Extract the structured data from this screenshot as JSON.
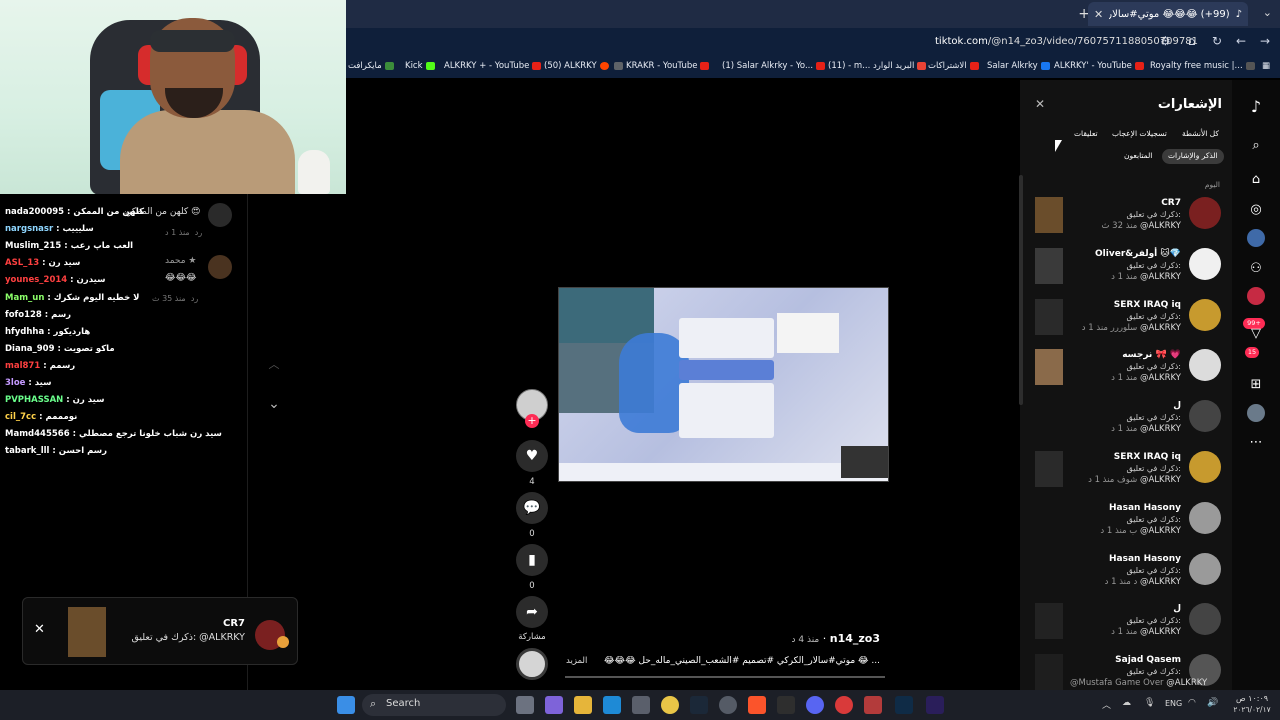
{
  "browser": {
    "tab_title": "(99+) 😂😂😂 موتي#سالار_الكر",
    "url_domain": "tiktok.com",
    "url_path": "/@n14_zo3/video/7607571188050709781",
    "bookmarks": [
      {
        "label": "مايكرافت",
        "color": "#3b8d3a"
      },
      {
        "label": "Kick",
        "color": "#53fc18"
      },
      {
        "label": "ALKRKY + - YouTube",
        "color": "#e62117"
      },
      {
        "label": "(50) ALKRKY",
        "color": "#ff4500"
      },
      {
        "label": "KRAKR - YouTube",
        "color": "#e62117"
      },
      {
        "label": "(1) Salar Alkrky - Yo...",
        "color": "#e62117"
      },
      {
        "label": "(11) - m... البريد الوارد",
        "color": "#ea4335"
      },
      {
        "label": "الاشتراكات",
        "color": "#e62117"
      },
      {
        "label": "Salar Alkrky",
        "color": "#1877f2"
      },
      {
        "label": "ALKRKY' - YouTube",
        "color": "#e62117"
      },
      {
        "label": "Royalty free music |...",
        "color": "#555555"
      }
    ]
  },
  "chat": {
    "top_comment": {
      "text": "كلهن من الممكن 😍",
      "time": "منذ 1 د",
      "reply": "رد"
    },
    "second_comment": {
      "name": "محمد ★",
      "text": "😂😂😂",
      "time": "منذ 35 ث",
      "reply": "رد"
    },
    "messages": [
      {
        "user": "nada200095",
        "color": "#ffffff",
        "text": "كلهن من الممكن",
        "user_color": "#ffffff"
      },
      {
        "user": "nargsnasr",
        "text": "سليييب",
        "user_color": "#8fd6ff"
      },
      {
        "user": "Muslim_215",
        "text": "العب ماپ رعب",
        "user_color": "#ffffff"
      },
      {
        "user": "ASL_13",
        "text": "سيد رن",
        "user_color": "#ff4040"
      },
      {
        "user": "younes_2014",
        "text": "سيدرن",
        "user_color": "#ff4040"
      },
      {
        "user": "Mam_un",
        "text": "لا خطيه اليوم شكرك",
        "user_color": "#8cff6a"
      },
      {
        "user": "fofo128",
        "text": "رسم",
        "user_color": "#ffffff"
      },
      {
        "user": "hfydhha",
        "text": "هارديكور",
        "user_color": "#ffffff"
      },
      {
        "user": "Diana_909",
        "text": "ماكو تصويت",
        "user_color": "#ffffff"
      },
      {
        "user": "mal871",
        "text": "رسمم",
        "user_color": "#ff4040"
      },
      {
        "user": "3loe",
        "text": "سيد",
        "user_color": "#c59aff"
      },
      {
        "user": "PVPHASSAN",
        "text": "سيد رن",
        "user_color": "#6aff8c"
      },
      {
        "user": "cil_7cc",
        "text": "نومممم",
        "user_color": "#ffd24a"
      },
      {
        "user": "Mamd445566",
        "text": "سيد رن شباب خلونا ترجع مصطلي",
        "user_color": "#ffffff"
      },
      {
        "user": "tabark_lll",
        "text": "رسم احسن",
        "user_color": "#ffffff"
      }
    ]
  },
  "toast": {
    "name": "CR7",
    "text": "ذكرك في تعليق: @ALKRKY"
  },
  "video": {
    "likes": "4",
    "comments": "0",
    "saves": "0",
    "share_label": "مشاركة",
    "author": "n14_zo3",
    "when": "منذ 4 د",
    "caption": "😂😂😂 موتي#سالار_الكركي #تصميم #الشعب_الصيني_ماله_حل 😂 ...",
    "more_label": "المزيد"
  },
  "notifications": {
    "title": "الإشعارات",
    "chips": [
      "كل الأنشطة",
      "تسجيلات الإعجاب",
      "تعليقات",
      "الذكر والإشارات",
      "المتابعون"
    ],
    "section": "اليوم",
    "items": [
      {
        "name": "CR7",
        "sub": "ذكرك في تعليق:",
        "meta": "@ALKRKY",
        "time": "منذ 32 ث",
        "av": "#7a2020",
        "thumb": "#6a4d2b"
      },
      {
        "name": "Oliver&أولفر 🐱💎",
        "sub": "ذكرك في تعليق:",
        "meta": "@ALKRKY",
        "time": "منذ 1 د",
        "av": "#f0f0f0",
        "thumb": "#3a3a3a"
      },
      {
        "name": "SERX IRAQ iq",
        "sub": "ذكرك في تعليق:",
        "meta": "@ALKRKY",
        "time": "سلوررر منذ 1 د",
        "av": "#c79a2e",
        "thumb": "#2a2a2a"
      },
      {
        "name": "نرجسه 🎀 💗",
        "sub": "ذكرك في تعليق:",
        "meta": "@ALKRKY",
        "time": "منذ 1 د",
        "av": "#dcdcdc",
        "thumb": "#8a6a4a"
      },
      {
        "name": "ل",
        "sub": "ذكرك في تعليق:",
        "meta": "@ALKRKY",
        "time": "منذ 1 د",
        "av": "#444444",
        "thumb": ""
      },
      {
        "name": "SERX IRAQ iq",
        "sub": "ذكرك في تعليق:",
        "meta": "@ALKRKY",
        "time": "شوف منذ 1 د",
        "av": "#c79a2e",
        "thumb": "#2a2a2a"
      },
      {
        "name": "Hasan Hasony",
        "sub": "ذكرك في تعليق:",
        "meta": "@ALKRKY",
        "time": "ب منذ 1 د",
        "av": "#9a9a9a",
        "thumb": ""
      },
      {
        "name": "Hasan Hasony",
        "sub": "ذكرك في تعليق:",
        "meta": "@ALKRKY",
        "time": "د منذ 1 د",
        "av": "#9a9a9a",
        "thumb": ""
      },
      {
        "name": "ل",
        "sub": "ذكرك في تعليق:",
        "meta": "@ALKRKY",
        "time": "منذ 1 د",
        "av": "#444444",
        "thumb": "#222222"
      },
      {
        "name": "Sajad Qasem",
        "sub": "ذكرك في تعليق:",
        "meta": "@ALKRKY",
        "time": "@Mustafa Game Over",
        "av": "#555555",
        "thumb": "#1e1e1e"
      }
    ]
  },
  "sidebar_badges": {
    "inbox": "99+",
    "messages": "15"
  },
  "taskbar": {
    "search_label": "Search",
    "language": "ENG",
    "time": "١٠:٠٩ ص",
    "date": "٢٠٢٦/٠٢/١٧"
  }
}
